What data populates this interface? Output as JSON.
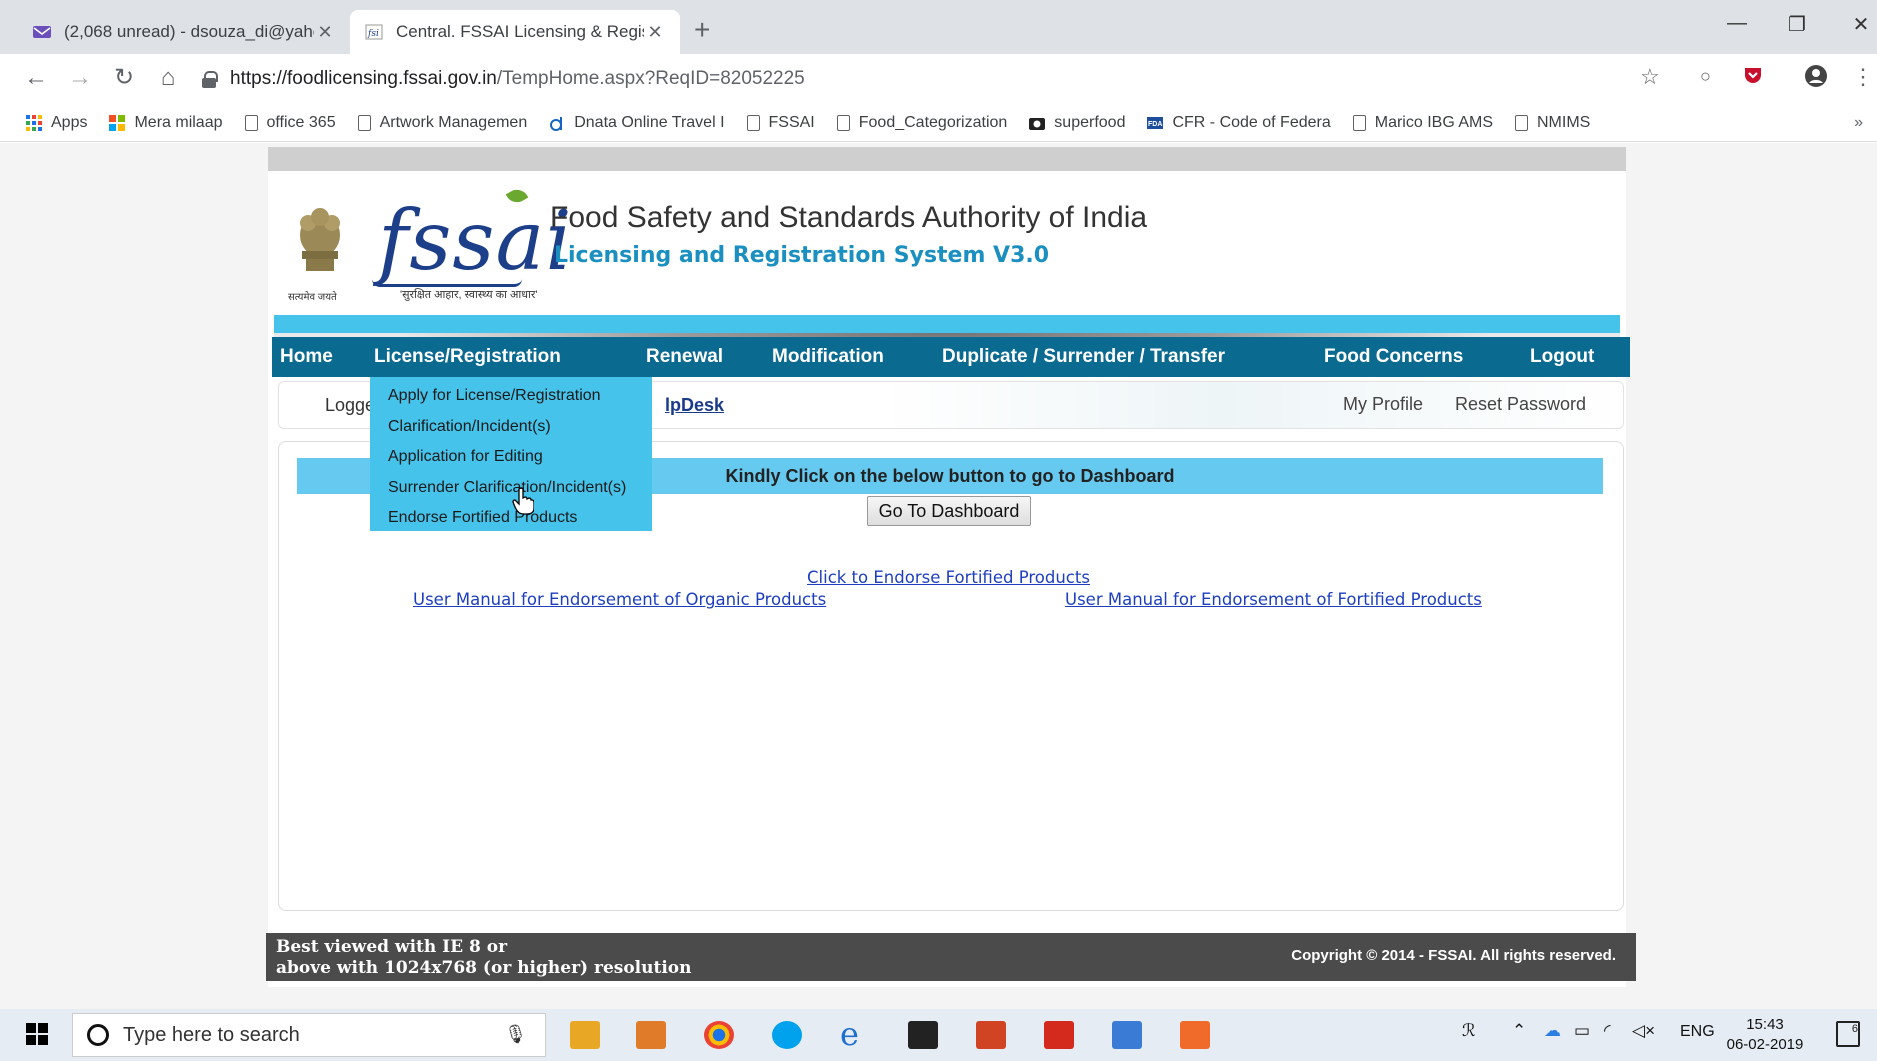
{
  "browser": {
    "tabs": [
      {
        "title": "(2,068 unread) - dsouza_di@yahc",
        "active": false
      },
      {
        "title": "Central. FSSAI Licensing & Regist",
        "active": true
      }
    ],
    "new_tab": "+",
    "url_host": "https://foodlicensing.fssai.gov.in",
    "url_path": "/TempHome.aspx?ReqID=82052225",
    "bookmarks": [
      {
        "label": "Apps",
        "icon": "apps-grid-icon"
      },
      {
        "label": "Mera milaap",
        "icon": "windows-logo-icon"
      },
      {
        "label": "office 365",
        "icon": "page-icon"
      },
      {
        "label": "Artwork Managemen",
        "icon": "page-icon"
      },
      {
        "label": "Dnata Online Travel I",
        "icon": "dnata-icon"
      },
      {
        "label": "FSSAI",
        "icon": "page-icon"
      },
      {
        "label": "Food_Categorization",
        "icon": "page-icon"
      },
      {
        "label": "superfood",
        "icon": "camera-icon"
      },
      {
        "label": "CFR - Code of Federa",
        "icon": "fda-icon"
      },
      {
        "label": "Marico IBG AMS",
        "icon": "page-icon"
      },
      {
        "label": "NMIMS",
        "icon": "page-icon"
      }
    ],
    "bookmarks_overflow": "»"
  },
  "site": {
    "emblem_motto": "सत्यमेव जयते",
    "logo_text": "fssai",
    "logo_tagline": "'सुरक्षित आहार, स्वास्थ्य का आधार'",
    "org_title": "Food Safety and Standards Authority of India",
    "org_subtitle": "Licensing and Registration System V3.0",
    "nav": [
      "Home",
      "License/Registration",
      "Renewal",
      "Modification",
      "Duplicate / Surrender / Transfer",
      "Food Concerns",
      "Logout"
    ],
    "dropdown": [
      "Apply for License/Registration",
      "Clarification/Incident(s)",
      "Application for Editing",
      "Surrender Clarification/Incident(s)",
      "Endorse Fortified Products"
    ],
    "logged_text": "Logge",
    "helpdesk_text": "lpDesk",
    "my_profile": "My Profile",
    "reset_password": "Reset Password",
    "kindly_text": "Kindly Click on the below button to go to Dashboard",
    "dashboard_button": "Go To Dashboard",
    "link_endorse": "Click to Endorse Fortified Products",
    "link_organic_manual": "User Manual for Endorsement of Organic Products",
    "link_fortified_manual": "User Manual for Endorsement of Fortified Products",
    "footer_line1": "Best viewed with IE 8 or",
    "footer_line2": "above with 1024x768 (or higher) resolution",
    "copyright": "Copyright © 2014 - FSSAI. All rights reserved."
  },
  "taskbar": {
    "search_placeholder": "Type here to search",
    "language": "ENG",
    "time": "15:43",
    "date": "06-02-2019",
    "notification_count": "6"
  },
  "colors": {
    "nav_bg": "#0a6a8f",
    "accent_cyan": "#45c3ea",
    "link_blue": "#1d3fbf"
  }
}
